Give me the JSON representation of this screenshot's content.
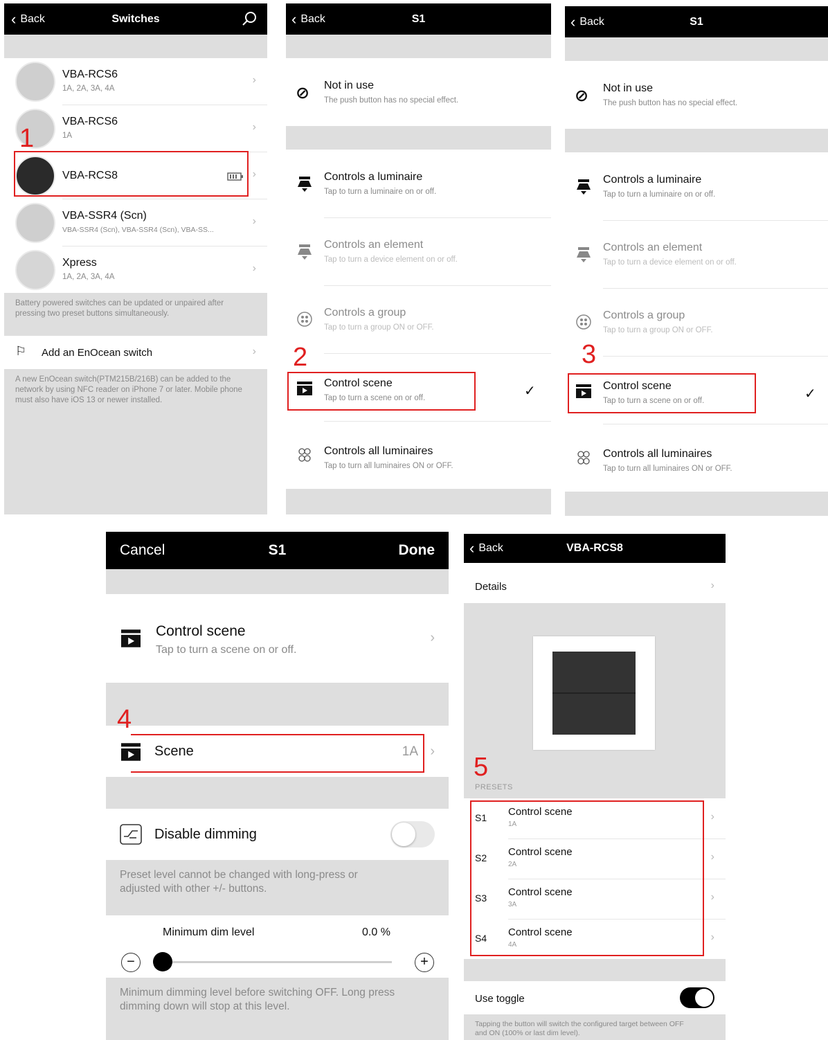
{
  "steps": [
    "1",
    "2",
    "3",
    "4",
    "5"
  ],
  "panel1": {
    "back": "Back",
    "title": "Switches",
    "switches": [
      {
        "name": "VBA-RCS6",
        "sub": "1A, 2A, 3A, 4A"
      },
      {
        "name": "VBA-RCS6",
        "sub": "1A"
      },
      {
        "name": "VBA-RCS8",
        "sub": ""
      },
      {
        "name": "VBA-SSR4 (Scn)",
        "sub": "VBA-SSR4 (Scn), VBA-SSR4 (Scn), VBA-SS..."
      },
      {
        "name": "Xpress",
        "sub": "1A, 2A, 3A, 4A"
      }
    ],
    "battery_note": "Battery powered switches can be updated or unpaired after pressing two preset buttons simultaneously.",
    "add_label": "Add an EnOcean switch",
    "add_note": "A new EnOcean switch(PTM215B/216B) can be added to the network by using NFC reader on iPhone 7 or later. Mobile phone must also have iOS 13 or newer installed."
  },
  "s1_panel": {
    "back": "Back",
    "title": "S1",
    "options": [
      {
        "title": "Not in use",
        "sub": "The push button has no special effect."
      },
      {
        "title": "Controls a luminaire",
        "sub": "Tap to turn a luminaire on or off."
      },
      {
        "title": "Controls an element",
        "sub": "Tap to turn a device element on or off."
      },
      {
        "title": "Controls a group",
        "sub": "Tap to turn a group ON or OFF."
      },
      {
        "title": "Control scene",
        "sub": "Tap to turn a scene on or off."
      },
      {
        "title": "Controls all luminaires",
        "sub": "Tap to turn all luminaires ON or OFF."
      }
    ],
    "check": "✓"
  },
  "panel4": {
    "cancel": "Cancel",
    "title": "S1",
    "done": "Done",
    "control_title": "Control scene",
    "control_sub": "Tap to turn a scene on or off.",
    "scene_label": "Scene",
    "scene_value": "1A",
    "disable_label": "Disable dimming",
    "disable_on": false,
    "preset_note": "Preset level cannot be changed with long-press or adjusted with other +/- buttons.",
    "min_dim_label": "Minimum dim level",
    "min_dim_value": "0.0 %",
    "slider_fraction": 0.0,
    "bottom_note": "Minimum dimming level before switching OFF. Long press dimming down will stop at this level."
  },
  "panel5": {
    "back": "Back",
    "title": "VBA-RCS8",
    "details": "Details",
    "presets_header": "PRESETS",
    "presets": [
      {
        "key": "S1",
        "title": "Control scene",
        "sub": "1A"
      },
      {
        "key": "S2",
        "title": "Control scene",
        "sub": "2A"
      },
      {
        "key": "S3",
        "title": "Control scene",
        "sub": "3A"
      },
      {
        "key": "S4",
        "title": "Control scene",
        "sub": "4A"
      }
    ],
    "toggle_label": "Use toggle",
    "toggle_on": true,
    "toggle_note": "Tapping the button will switch the configured target between OFF and ON (100% or last dim level)."
  },
  "colors": {
    "accent_red": "#e02020",
    "nav_bg": "#000000",
    "grey_bg": "#dedede"
  }
}
